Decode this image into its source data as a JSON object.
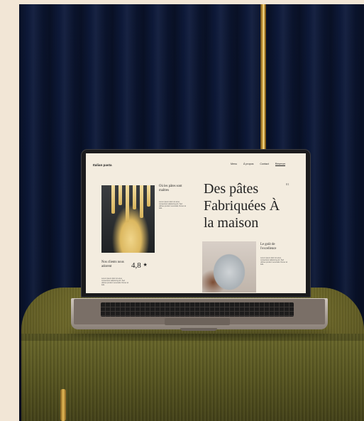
{
  "site": {
    "logo": "Italian pasta",
    "nav": [
      "Menu",
      "À propos",
      "Contact",
      "Réserver"
    ],
    "hero_title": "Des pâtes Fabriquées À la maison",
    "hero_number": "01",
    "caption_top": "Où les pâtes sont maîtres",
    "caption_bottom": "Le goût de l'excellence",
    "clients_label": "Nos clients nous adorent",
    "rating": "4,8",
    "star_icon": "★",
    "lorem_a": "Lorem ipsum dolor sit amet, consectetur adipiscing elit. Sed ultrices pretium venenatis. Donec at felis.",
    "lorem_b": "Lorem ipsum dolor sit amet, consectetur adipiscing elit. Sed ultrices pretium venenatis. Donec at felis.",
    "lorem_c": "Lorem ipsum dolor sit amet, consectetur adipiscing elit. Sed ultrices pretium venenatis. Donec at felis."
  },
  "colors": {
    "curtain": "#0e1a3b",
    "background": "#f2e6d6",
    "ottoman": "#6a6528",
    "gold": "#e0b24a",
    "screen": "#f3ecdf"
  }
}
